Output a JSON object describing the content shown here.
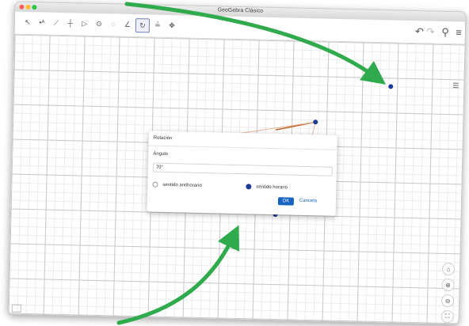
{
  "window": {
    "title": "GeoGebra Clásico"
  },
  "toolbar": {
    "tools": [
      "move-icon",
      "point-icon",
      "line-icon",
      "perpendicular-icon",
      "polygon-icon",
      "circle-icon",
      "circle-three-points-icon",
      "angle-icon",
      "rotate-icon",
      "slider-icon",
      "move-view-icon"
    ],
    "selected_index": 8
  },
  "dialog": {
    "title": "Rotación",
    "label": "Ángulo",
    "value": "70°",
    "radio_counterclockwise": "sentido antihorario",
    "radio_clockwise": "sentido horario",
    "selected": "sentido horario",
    "ok_label": "OK",
    "cancel_label": "Cancela"
  },
  "colors": {
    "accent": "#1565c0",
    "point": "#1f3a93",
    "segment": "#c0672b",
    "arrow": "#2faa4c"
  }
}
